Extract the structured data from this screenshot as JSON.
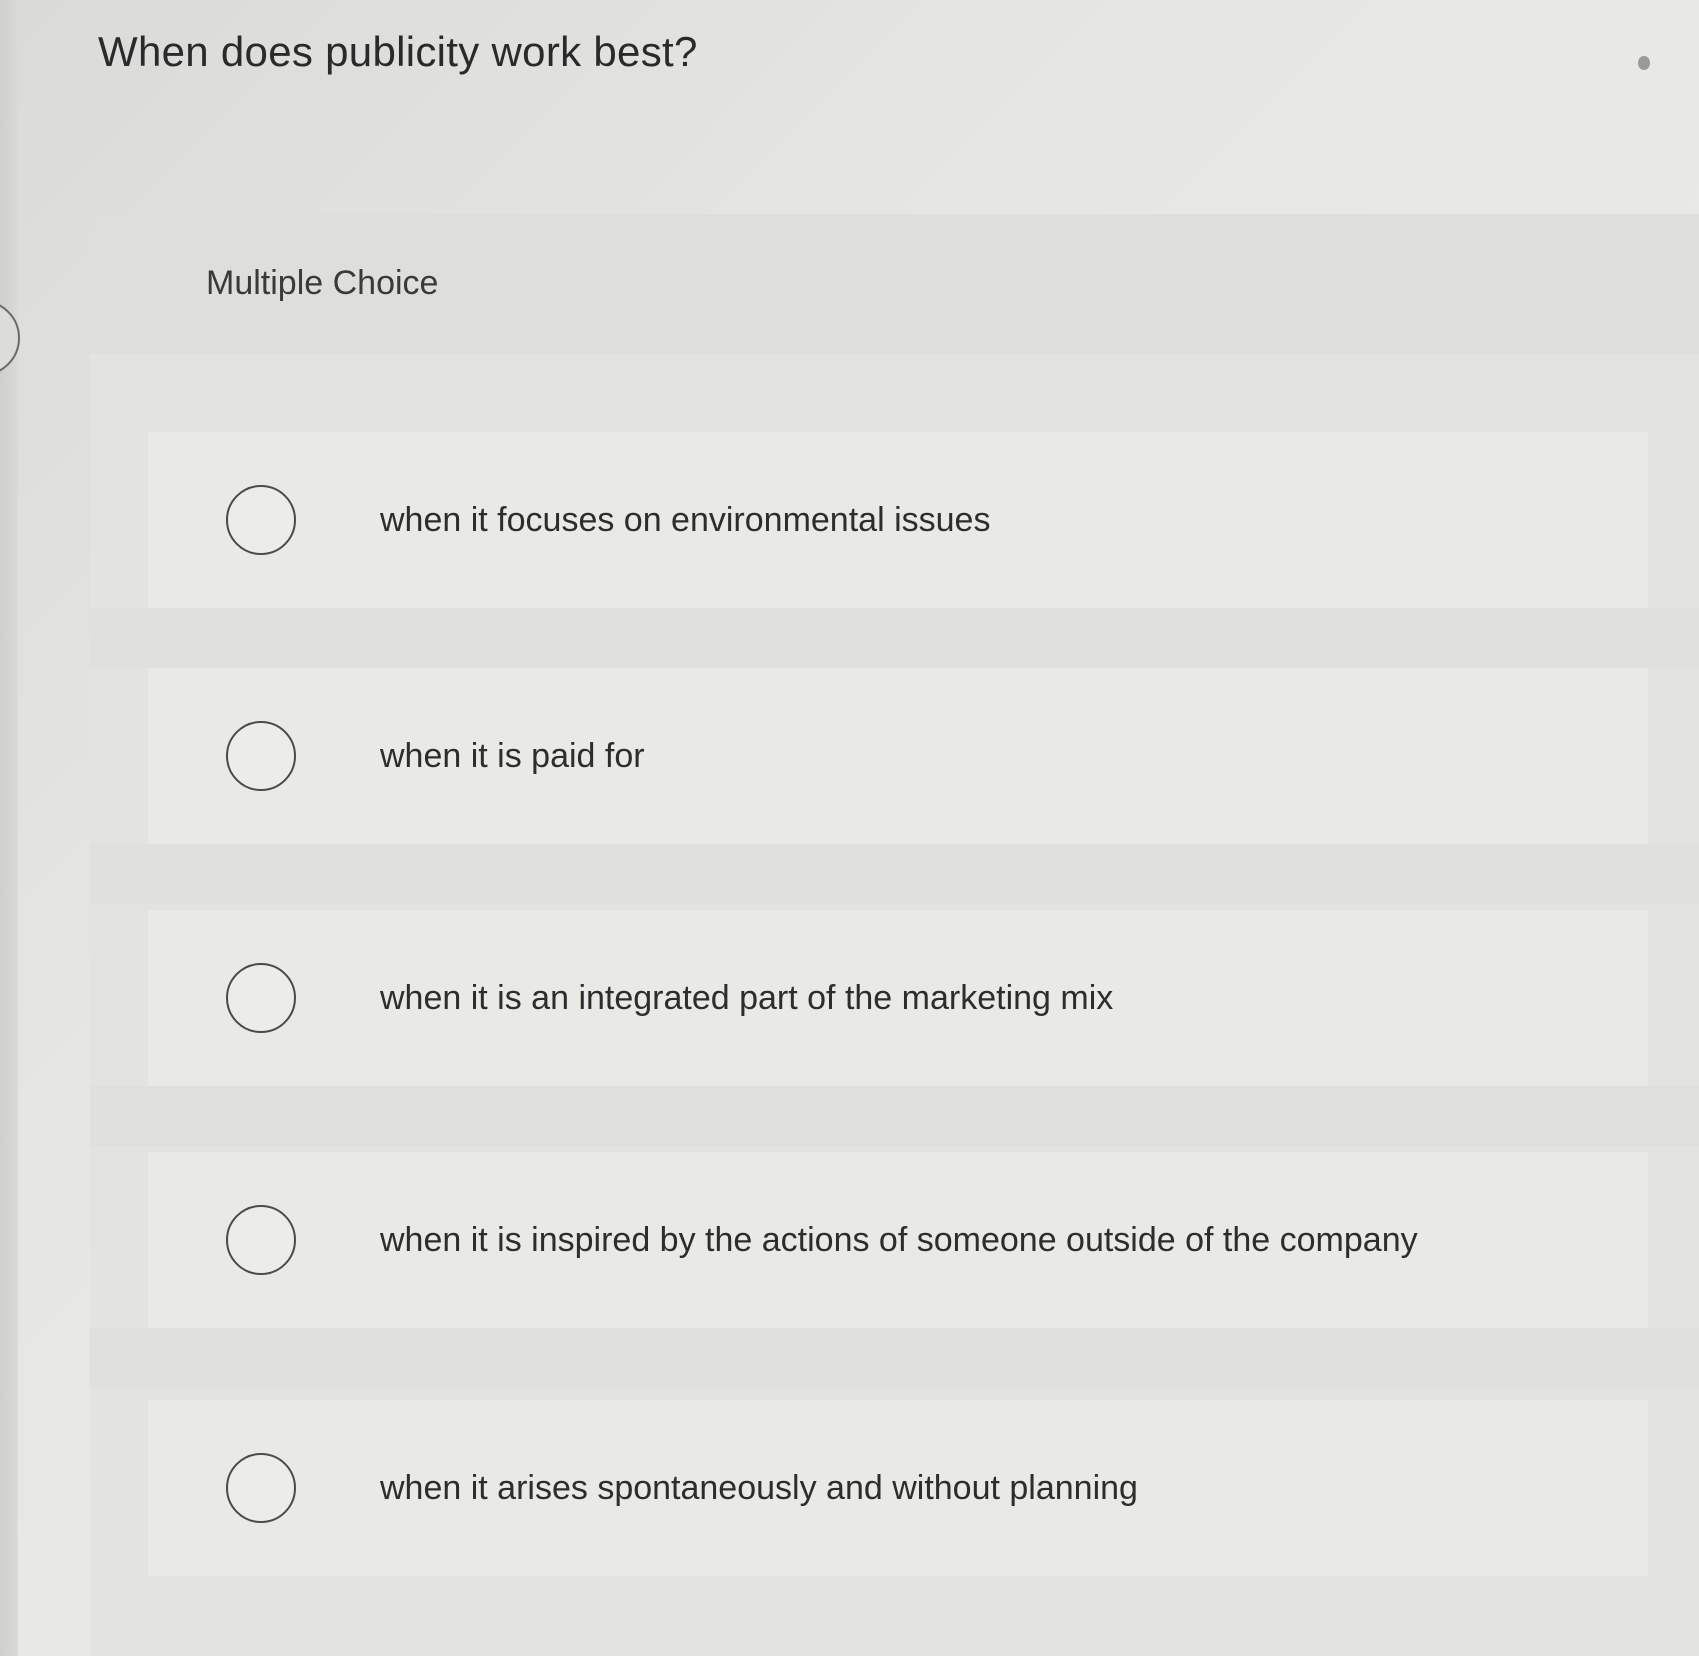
{
  "question": {
    "text": "When does publicity work best?"
  },
  "choice_panel": {
    "type_label": "Multiple Choice",
    "options": [
      {
        "label": "when it focuses on environmental issues",
        "selected": false
      },
      {
        "label": "when it is paid for",
        "selected": false
      },
      {
        "label": "when it is an integrated part of the marketing mix",
        "selected": false
      },
      {
        "label": "when it is inspired by the actions of someone outside of the company",
        "selected": false
      },
      {
        "label": "when it arises spontaneously and without planning",
        "selected": false
      }
    ]
  }
}
